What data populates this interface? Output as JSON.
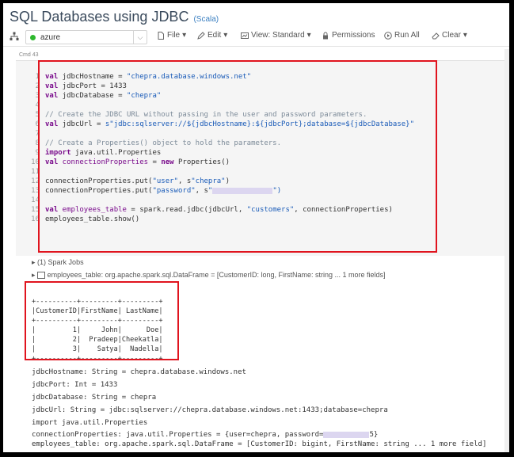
{
  "notebook": {
    "title": "SQL Databases using JDBC",
    "language": "(Scala)"
  },
  "toolbar": {
    "cluster_name": "azure",
    "items": [
      {
        "label": "File",
        "icon": "file-icon"
      },
      {
        "label": "Edit",
        "icon": "edit-icon"
      },
      {
        "label": "View: Standard",
        "icon": "view-icon"
      },
      {
        "label": "Permissions",
        "icon": "lock-icon"
      },
      {
        "label": "Run All",
        "icon": "play-icon"
      },
      {
        "label": "Clear",
        "icon": "eraser-icon"
      }
    ]
  },
  "cell": {
    "cmd_label": "Cmd 43",
    "line_numbers": [
      "1",
      "2",
      "3",
      "4",
      "5",
      "6",
      "7",
      "8",
      "9",
      "10",
      "11",
      "12",
      "13",
      "14",
      "15",
      "16"
    ]
  },
  "output": {
    "spark_jobs": "(1) Spark Jobs",
    "dataframe_info": "employees_table:  org.apache.spark.sql.DataFrame = [CustomerID: long, FirstName: string ... 1 more fields]",
    "table_lines": [
      "+----------+---------+---------+",
      "|CustomerID|FirstName| LastName|",
      "+----------+---------+---------+",
      "|         1|     John|      Doe|",
      "|         2|  Pradeep|Cheekatla|",
      "|         3|    Satya|  Nadella|",
      "+----------+---------+---------+"
    ],
    "result_lines": [
      "jdbcHostname: String = chepra.database.windows.net",
      "jdbcPort: Int = 1433",
      "jdbcDatabase: String = chepra",
      "jdbcUrl: String = jdbc:sqlserver://chepra.database.windows.net:1433;database=chepra",
      "import java.util.Properties",
      "employees_table: org.apache.spark.sql.DataFrame = [CustomerID: bigint, FirstName: string ... 1 more field]"
    ],
    "conn_props_prefix": "connectionProperties: java.util.Properties = {user=chepra, password=",
    "conn_props_suffix": "5}"
  },
  "code": {
    "l1_kw": "val",
    "l1_name": " jdbcHostname = ",
    "l1_val": "\"chepra.database.windows.net\"",
    "l2_kw": "val",
    "l2_name": " jdbcPort = ",
    "l2_val": "1433",
    "l3_kw": "val",
    "l3_name": " jdbcDatabase = ",
    "l3_val": "\"chepra\"",
    "l5": "// Create the JDBC URL without passing in the user and password parameters.",
    "l6_kw": "val",
    "l6_name": " jdbcUrl = ",
    "l6_val": "s\"jdbc:sqlserver://${jdbcHostname}:${jdbcPort};database=${jdbcDatabase}\"",
    "l8": "// Create a Properties() object to hold the parameters.",
    "l9_kw": "import",
    "l9_rest": " java.util.Properties",
    "l10_kw": "val",
    "l10_name": " connectionProperties",
    "l10_eq": " = ",
    "l10_new": "new",
    "l10_rest": " Properties()",
    "l12_a": "connectionProperties.put(",
    "l12_b": "\"user\"",
    "l12_c": ", s",
    "l12_d": "\"chepra\"",
    "l12_e": ")",
    "l13_a": "connectionProperties.put(",
    "l13_b": "\"password\"",
    "l13_c": ", s",
    "l13_d": "\"",
    "l13_e": "\")",
    "l15_kw": "val",
    "l15_name": " employees_table",
    "l15_a": " = spark.read.jdbc(jdbcUrl, ",
    "l15_b": "\"customers\"",
    "l15_c": ", connectionProperties)",
    "l16": "employees_table.show()"
  },
  "colors": {
    "highlight": "#e0141e",
    "keyword": "#7a0c8c",
    "string": "#1a5bb8",
    "comment": "#7d8b99"
  }
}
